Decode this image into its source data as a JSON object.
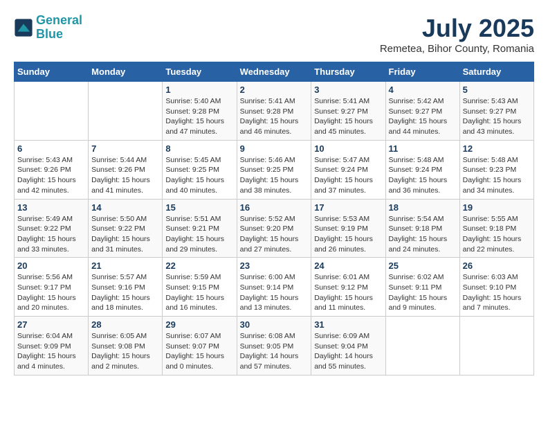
{
  "header": {
    "logo_line1": "General",
    "logo_line2": "Blue",
    "title": "July 2025",
    "subtitle": "Remetea, Bihor County, Romania"
  },
  "calendar": {
    "days_of_week": [
      "Sunday",
      "Monday",
      "Tuesday",
      "Wednesday",
      "Thursday",
      "Friday",
      "Saturday"
    ],
    "weeks": [
      [
        {
          "day": "",
          "info": ""
        },
        {
          "day": "",
          "info": ""
        },
        {
          "day": "1",
          "info": "Sunrise: 5:40 AM\nSunset: 9:28 PM\nDaylight: 15 hours and 47 minutes."
        },
        {
          "day": "2",
          "info": "Sunrise: 5:41 AM\nSunset: 9:28 PM\nDaylight: 15 hours and 46 minutes."
        },
        {
          "day": "3",
          "info": "Sunrise: 5:41 AM\nSunset: 9:27 PM\nDaylight: 15 hours and 45 minutes."
        },
        {
          "day": "4",
          "info": "Sunrise: 5:42 AM\nSunset: 9:27 PM\nDaylight: 15 hours and 44 minutes."
        },
        {
          "day": "5",
          "info": "Sunrise: 5:43 AM\nSunset: 9:27 PM\nDaylight: 15 hours and 43 minutes."
        }
      ],
      [
        {
          "day": "6",
          "info": "Sunrise: 5:43 AM\nSunset: 9:26 PM\nDaylight: 15 hours and 42 minutes."
        },
        {
          "day": "7",
          "info": "Sunrise: 5:44 AM\nSunset: 9:26 PM\nDaylight: 15 hours and 41 minutes."
        },
        {
          "day": "8",
          "info": "Sunrise: 5:45 AM\nSunset: 9:25 PM\nDaylight: 15 hours and 40 minutes."
        },
        {
          "day": "9",
          "info": "Sunrise: 5:46 AM\nSunset: 9:25 PM\nDaylight: 15 hours and 38 minutes."
        },
        {
          "day": "10",
          "info": "Sunrise: 5:47 AM\nSunset: 9:24 PM\nDaylight: 15 hours and 37 minutes."
        },
        {
          "day": "11",
          "info": "Sunrise: 5:48 AM\nSunset: 9:24 PM\nDaylight: 15 hours and 36 minutes."
        },
        {
          "day": "12",
          "info": "Sunrise: 5:48 AM\nSunset: 9:23 PM\nDaylight: 15 hours and 34 minutes."
        }
      ],
      [
        {
          "day": "13",
          "info": "Sunrise: 5:49 AM\nSunset: 9:22 PM\nDaylight: 15 hours and 33 minutes."
        },
        {
          "day": "14",
          "info": "Sunrise: 5:50 AM\nSunset: 9:22 PM\nDaylight: 15 hours and 31 minutes."
        },
        {
          "day": "15",
          "info": "Sunrise: 5:51 AM\nSunset: 9:21 PM\nDaylight: 15 hours and 29 minutes."
        },
        {
          "day": "16",
          "info": "Sunrise: 5:52 AM\nSunset: 9:20 PM\nDaylight: 15 hours and 27 minutes."
        },
        {
          "day": "17",
          "info": "Sunrise: 5:53 AM\nSunset: 9:19 PM\nDaylight: 15 hours and 26 minutes."
        },
        {
          "day": "18",
          "info": "Sunrise: 5:54 AM\nSunset: 9:18 PM\nDaylight: 15 hours and 24 minutes."
        },
        {
          "day": "19",
          "info": "Sunrise: 5:55 AM\nSunset: 9:18 PM\nDaylight: 15 hours and 22 minutes."
        }
      ],
      [
        {
          "day": "20",
          "info": "Sunrise: 5:56 AM\nSunset: 9:17 PM\nDaylight: 15 hours and 20 minutes."
        },
        {
          "day": "21",
          "info": "Sunrise: 5:57 AM\nSunset: 9:16 PM\nDaylight: 15 hours and 18 minutes."
        },
        {
          "day": "22",
          "info": "Sunrise: 5:59 AM\nSunset: 9:15 PM\nDaylight: 15 hours and 16 minutes."
        },
        {
          "day": "23",
          "info": "Sunrise: 6:00 AM\nSunset: 9:14 PM\nDaylight: 15 hours and 13 minutes."
        },
        {
          "day": "24",
          "info": "Sunrise: 6:01 AM\nSunset: 9:12 PM\nDaylight: 15 hours and 11 minutes."
        },
        {
          "day": "25",
          "info": "Sunrise: 6:02 AM\nSunset: 9:11 PM\nDaylight: 15 hours and 9 minutes."
        },
        {
          "day": "26",
          "info": "Sunrise: 6:03 AM\nSunset: 9:10 PM\nDaylight: 15 hours and 7 minutes."
        }
      ],
      [
        {
          "day": "27",
          "info": "Sunrise: 6:04 AM\nSunset: 9:09 PM\nDaylight: 15 hours and 4 minutes."
        },
        {
          "day": "28",
          "info": "Sunrise: 6:05 AM\nSunset: 9:08 PM\nDaylight: 15 hours and 2 minutes."
        },
        {
          "day": "29",
          "info": "Sunrise: 6:07 AM\nSunset: 9:07 PM\nDaylight: 15 hours and 0 minutes."
        },
        {
          "day": "30",
          "info": "Sunrise: 6:08 AM\nSunset: 9:05 PM\nDaylight: 14 hours and 57 minutes."
        },
        {
          "day": "31",
          "info": "Sunrise: 6:09 AM\nSunset: 9:04 PM\nDaylight: 14 hours and 55 minutes."
        },
        {
          "day": "",
          "info": ""
        },
        {
          "day": "",
          "info": ""
        }
      ]
    ]
  }
}
